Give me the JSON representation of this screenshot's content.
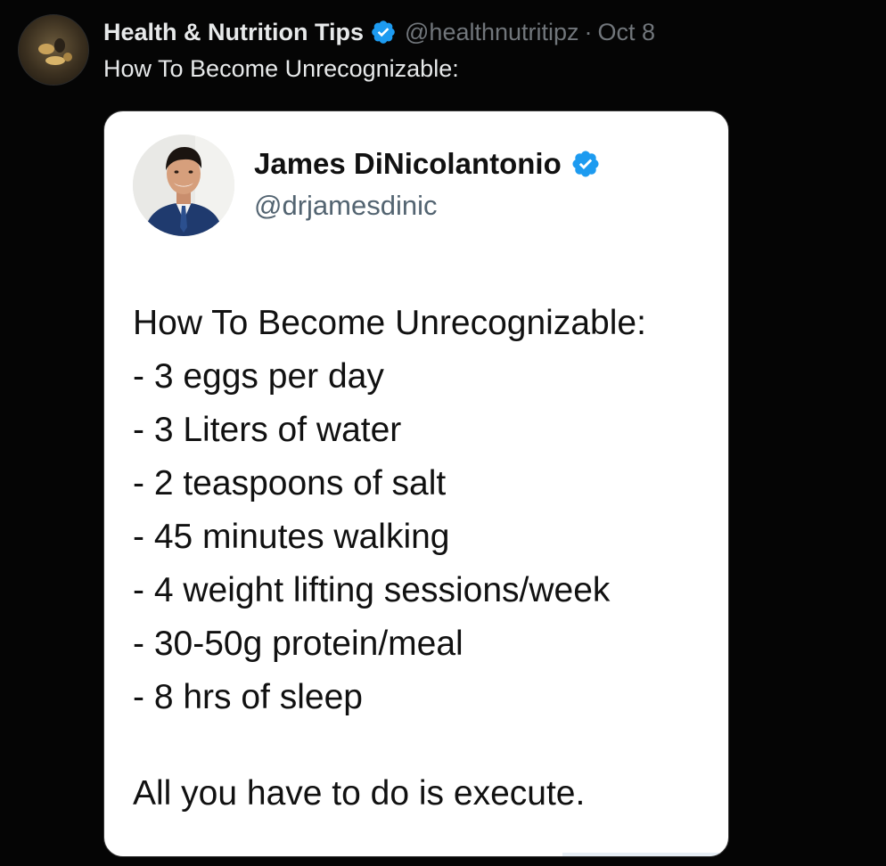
{
  "post": {
    "author_name": "Health & Nutrition Tips",
    "author_handle": "@healthnutritipz",
    "separator": "·",
    "date": "Oct 8",
    "text": "How To Become Unrecognizable:",
    "avatar_icon": "supplement-pills-avatar",
    "verified_color": "#1d9bf0"
  },
  "media": {
    "inner_name": "James DiNicolantonio",
    "inner_handle": "@drjamesdinic",
    "inner_avatar": "man-in-suit-portrait",
    "heading": "How To Become Unrecognizable:",
    "list": [
      "- 3 eggs per day",
      "- 3 Liters of water",
      "- 2 teaspoons of salt",
      "- 45 minutes walking",
      "- 4 weight lifting sessions/week",
      "- 30-50g protein/meal",
      "- 8 hrs of sleep"
    ],
    "closing": "All you have to do is execute."
  }
}
